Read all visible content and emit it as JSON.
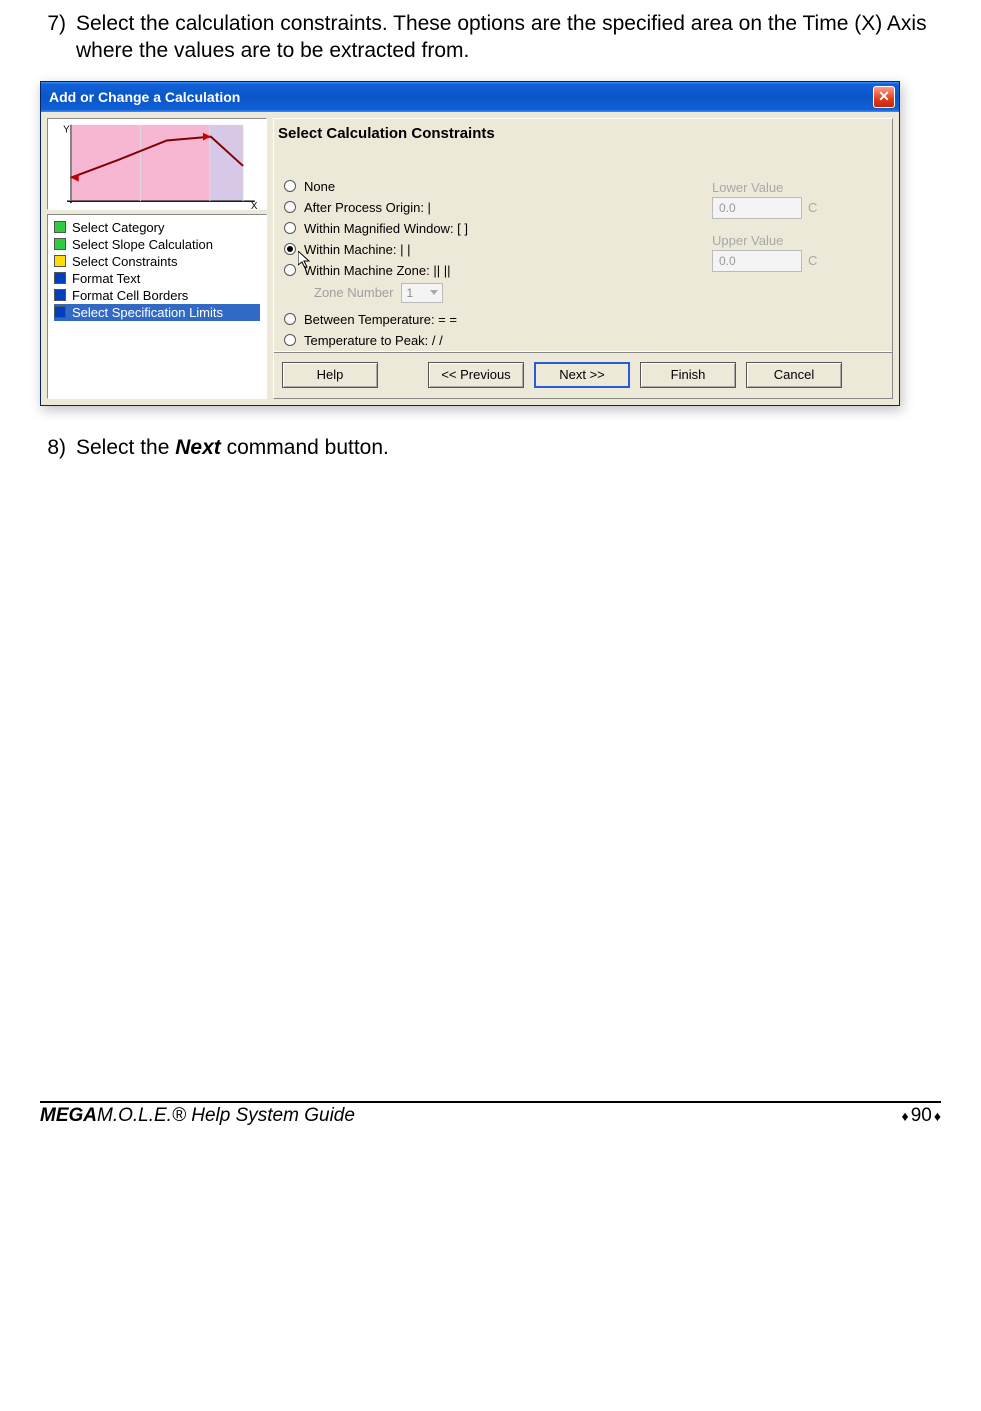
{
  "step7": {
    "num": "7)",
    "text": "Select the calculation constraints. These options are the specified area on the Time (X) Axis where the values are to be extracted from."
  },
  "step8": {
    "num": "8)",
    "pre": "Select the ",
    "bold": "Next",
    "post": " command button."
  },
  "dialog": {
    "title": "Add or Change a Calculation",
    "steps": [
      {
        "color": "green",
        "label": "Select Category"
      },
      {
        "color": "green",
        "label": "Select Slope Calculation"
      },
      {
        "color": "yellow",
        "label": "Select Constraints"
      },
      {
        "color": "blue",
        "label": "Format Text"
      },
      {
        "color": "blue",
        "label": "Format Cell Borders"
      },
      {
        "color": "blue",
        "label": "Select Specification Limits"
      }
    ],
    "heading": "Select Calculation Constraints",
    "radios": {
      "none": "None",
      "after_origin": "After Process Origin: |",
      "magnified": "Within Magnified Window: [  ]",
      "machine": "Within Machine: |  |",
      "machine_zone": "Within Machine Zone: ||  ||",
      "zone_label": "Zone Number",
      "zone_value": "1",
      "between_temp": "Between Temperature: =  =",
      "temp_peak": "Temperature to Peak: /  /"
    },
    "values": {
      "lower_label": "Lower Value",
      "lower_value": "0.0",
      "upper_label": "Upper Value",
      "upper_value": "0.0",
      "unit": "C"
    },
    "buttons": {
      "help": "Help",
      "prev": "<< Previous",
      "next": "Next >>",
      "finish": "Finish",
      "cancel": "Cancel"
    }
  },
  "footer": {
    "brand_bold": "MEGA",
    "brand_rest": "M.O.L.E.® Help System Guide",
    "page": "90"
  }
}
